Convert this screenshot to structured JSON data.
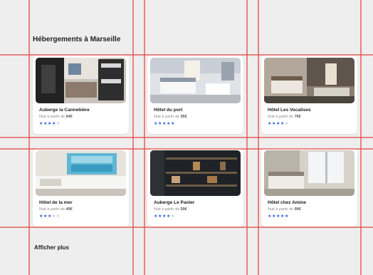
{
  "page": {
    "heading": "Hébergements à Marseille",
    "show_more_label": "Afficher plus"
  },
  "hotels": [
    {
      "name": "Auberge la Cannebière",
      "price_prefix": "Nuit à partir de",
      "price": "64€",
      "rating": 4,
      "max_rating": 5,
      "photo": "bunk-room-photo"
    },
    {
      "name": "Hôtel du port",
      "price_prefix": "Nuit à partir de",
      "price": "95€",
      "rating": 5,
      "max_rating": 5,
      "photo": "bright-bedroom-photo"
    },
    {
      "name": "Hôtel Les Vocalises",
      "price_prefix": "Nuit à partir de",
      "price": "76€",
      "rating": 4,
      "max_rating": 5,
      "photo": "dim-bedroom-photo"
    },
    {
      "name": "Hôtel de la mer",
      "price_prefix": "Nuit à partir de",
      "price": "49€",
      "rating": 3,
      "max_rating": 5,
      "photo": "sea-art-bedroom-photo"
    },
    {
      "name": "Auberge Le Panier",
      "price_prefix": "Nuit à partir de",
      "price": "59€",
      "rating": 4,
      "max_rating": 5,
      "photo": "dark-shelves-photo"
    },
    {
      "name": "Hôtel chez Amine",
      "price_prefix": "Nuit à partir de",
      "price": "99€",
      "rating": 5,
      "max_rating": 5,
      "photo": "window-bedroom-photo"
    }
  ],
  "colors": {
    "background": "#eeeeee",
    "card": "#ffffff",
    "star_active": "#2f5fd6",
    "star_inactive": "#c9c9c9",
    "guide_lines": "#e64646"
  }
}
